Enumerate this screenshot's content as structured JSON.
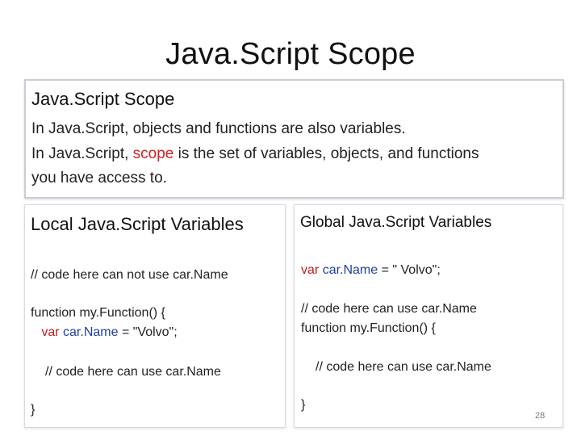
{
  "slide": {
    "title": "Java.Script Scope",
    "page_number": "28"
  },
  "intro": {
    "heading": "Java.Script Scope",
    "line1": "In Java.Script, objects and functions are also variables.",
    "line2_before": "In Java.Script, ",
    "line2_highlight": "scope",
    "line2_after": " is the set of variables, objects, and functions",
    "line3": "you have access to."
  },
  "local": {
    "title": "Local Java.Script Variables",
    "comment_outside": "// code here can not use car.Name",
    "func_decl": "function my.Function() {",
    "indent": "   ",
    "var_keyword": "var",
    "var_name": "car.Name",
    "assign_value": " = \"Volvo\";",
    "comment_inside": "// code here can use car.Name",
    "closing_brace": "}"
  },
  "global": {
    "title": "Global Java.Script Variables",
    "var_keyword": "var",
    "var_name": "car.Name",
    "assign_value": " = \" Volvo\";",
    "comment_outside": "// code here can use car.Name",
    "func_decl": "function my.Function() {",
    "comment_inside": "// code here can use car.Name",
    "closing_brace": "}"
  },
  "colors": {
    "highlight_red": "#d21f1f",
    "keyword_red": "#c41a1a",
    "identifier_blue": "#1f3f9e",
    "border_gray": "#c9ced6"
  }
}
